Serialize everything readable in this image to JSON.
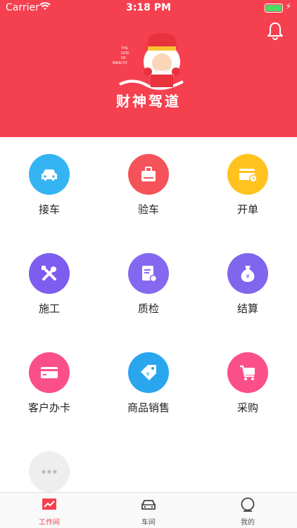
{
  "status_bar": {
    "carrier": "Carrier",
    "time": "3:18 PM"
  },
  "header": {
    "brand_title": "财神驾道",
    "logo_text": "THE GOD OF WEALTH",
    "bell_icon": "bell-icon",
    "background_color": "#f5404f"
  },
  "grid": {
    "items": [
      {
        "label": "接车",
        "icon": "car-icon",
        "color": "#35b4f4"
      },
      {
        "label": "验车",
        "icon": "toolbox-icon",
        "color": "#f5535a"
      },
      {
        "label": "开单",
        "icon": "card-clock-icon",
        "color": "#ffc21f"
      },
      {
        "label": "施工",
        "icon": "tools-icon",
        "color": "#7d5df0"
      },
      {
        "label": "质检",
        "icon": "document-icon",
        "color": "#8468ef"
      },
      {
        "label": "结算",
        "icon": "money-bag-icon",
        "color": "#8066ec"
      },
      {
        "label": "客户办卡",
        "icon": "bank-card-icon",
        "color": "#fb4f8a"
      },
      {
        "label": "商品销售",
        "icon": "price-tag-icon",
        "color": "#2aa6ee"
      },
      {
        "label": "采购",
        "icon": "shopping-cart-icon",
        "color": "#fb4f8a"
      },
      {
        "label": "",
        "icon": "more-icon",
        "color": "#eeeeee"
      }
    ]
  },
  "tabbar": {
    "tabs": [
      {
        "label": "工作间",
        "icon": "workspace-chart-icon",
        "active": true
      },
      {
        "label": "车间",
        "icon": "car-front-icon",
        "active": false
      },
      {
        "label": "我的",
        "icon": "profile-circle-icon",
        "active": false
      }
    ],
    "active_color": "#f5404f"
  }
}
